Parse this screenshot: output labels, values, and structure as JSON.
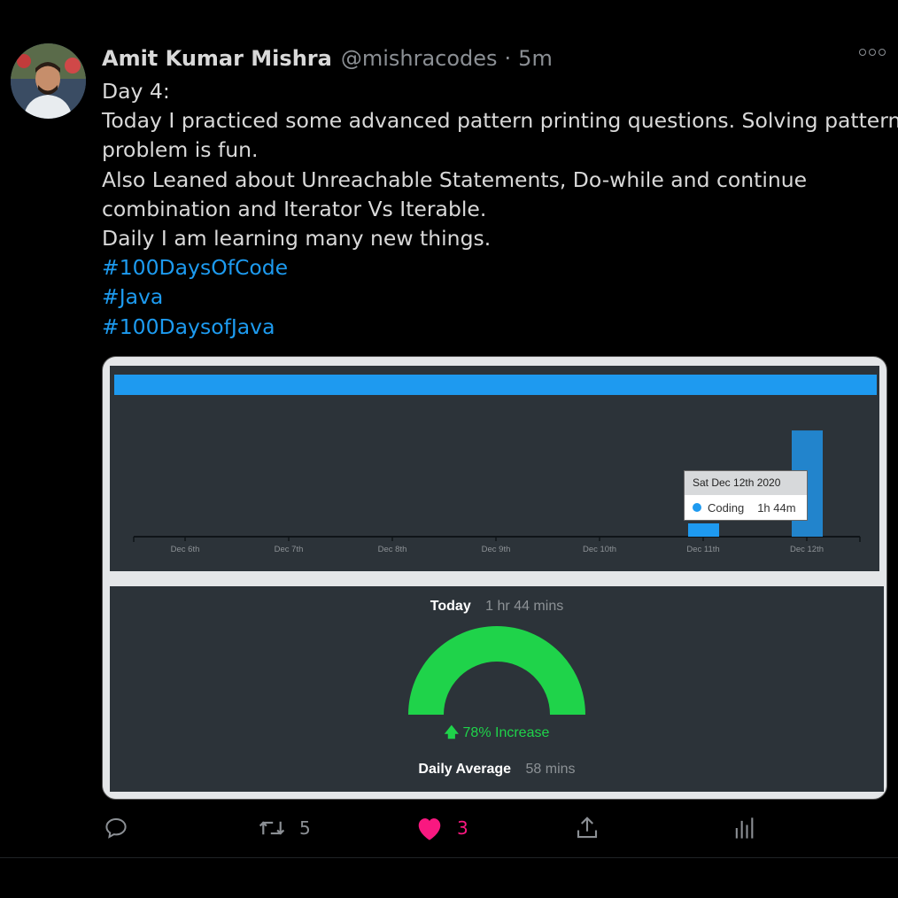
{
  "tweet": {
    "author_name": "Amit Kumar Mishra",
    "handle": "@mishracodes",
    "separator": "·",
    "time": "5m",
    "lines": [
      "Day 4:",
      "Today I practiced some advanced pattern printing questions. Solving pattern",
      "problem is fun.",
      "Also Leaned about Unreachable Statements, Do-while and continue",
      "combination and Iterator Vs Iterable.",
      "Daily I am learning many new things."
    ],
    "hashtags": [
      "#100DaysOfCode",
      "#Java",
      "#100DaysofJava"
    ]
  },
  "chart_data": {
    "type": "bar",
    "categories": [
      "Dec 6th",
      "Dec 7th",
      "Dec 8th",
      "Dec 9th",
      "Dec 10th",
      "Dec 11th",
      "Dec 12th"
    ],
    "series": [
      {
        "name": "Coding",
        "values": [
          0,
          0,
          0,
          0,
          0,
          13,
          104
        ]
      }
    ],
    "ylim": [
      0,
      124
    ],
    "grid": false,
    "colors": {
      "bar": "#2284cc",
      "bar_hover": "#1e9af0",
      "background": "#2c3339"
    },
    "tooltip": {
      "title": "Sat Dec 12th 2020",
      "series": "Coding",
      "value": "1h 44m"
    }
  },
  "summary": {
    "today_label": "Today",
    "today_value": "1 hr 44 mins",
    "gauge_fraction": 1.0,
    "gauge_color": "#1fd34a",
    "increase_text": "78% Increase",
    "average_label": "Daily Average",
    "average_value": "58 mins"
  },
  "actions": {
    "reply_icon": "reply-icon",
    "retweet_count": "5",
    "like_count": "3",
    "like_color": "#f91880",
    "share_icon": "share-icon",
    "analytics_icon": "analytics-icon"
  }
}
